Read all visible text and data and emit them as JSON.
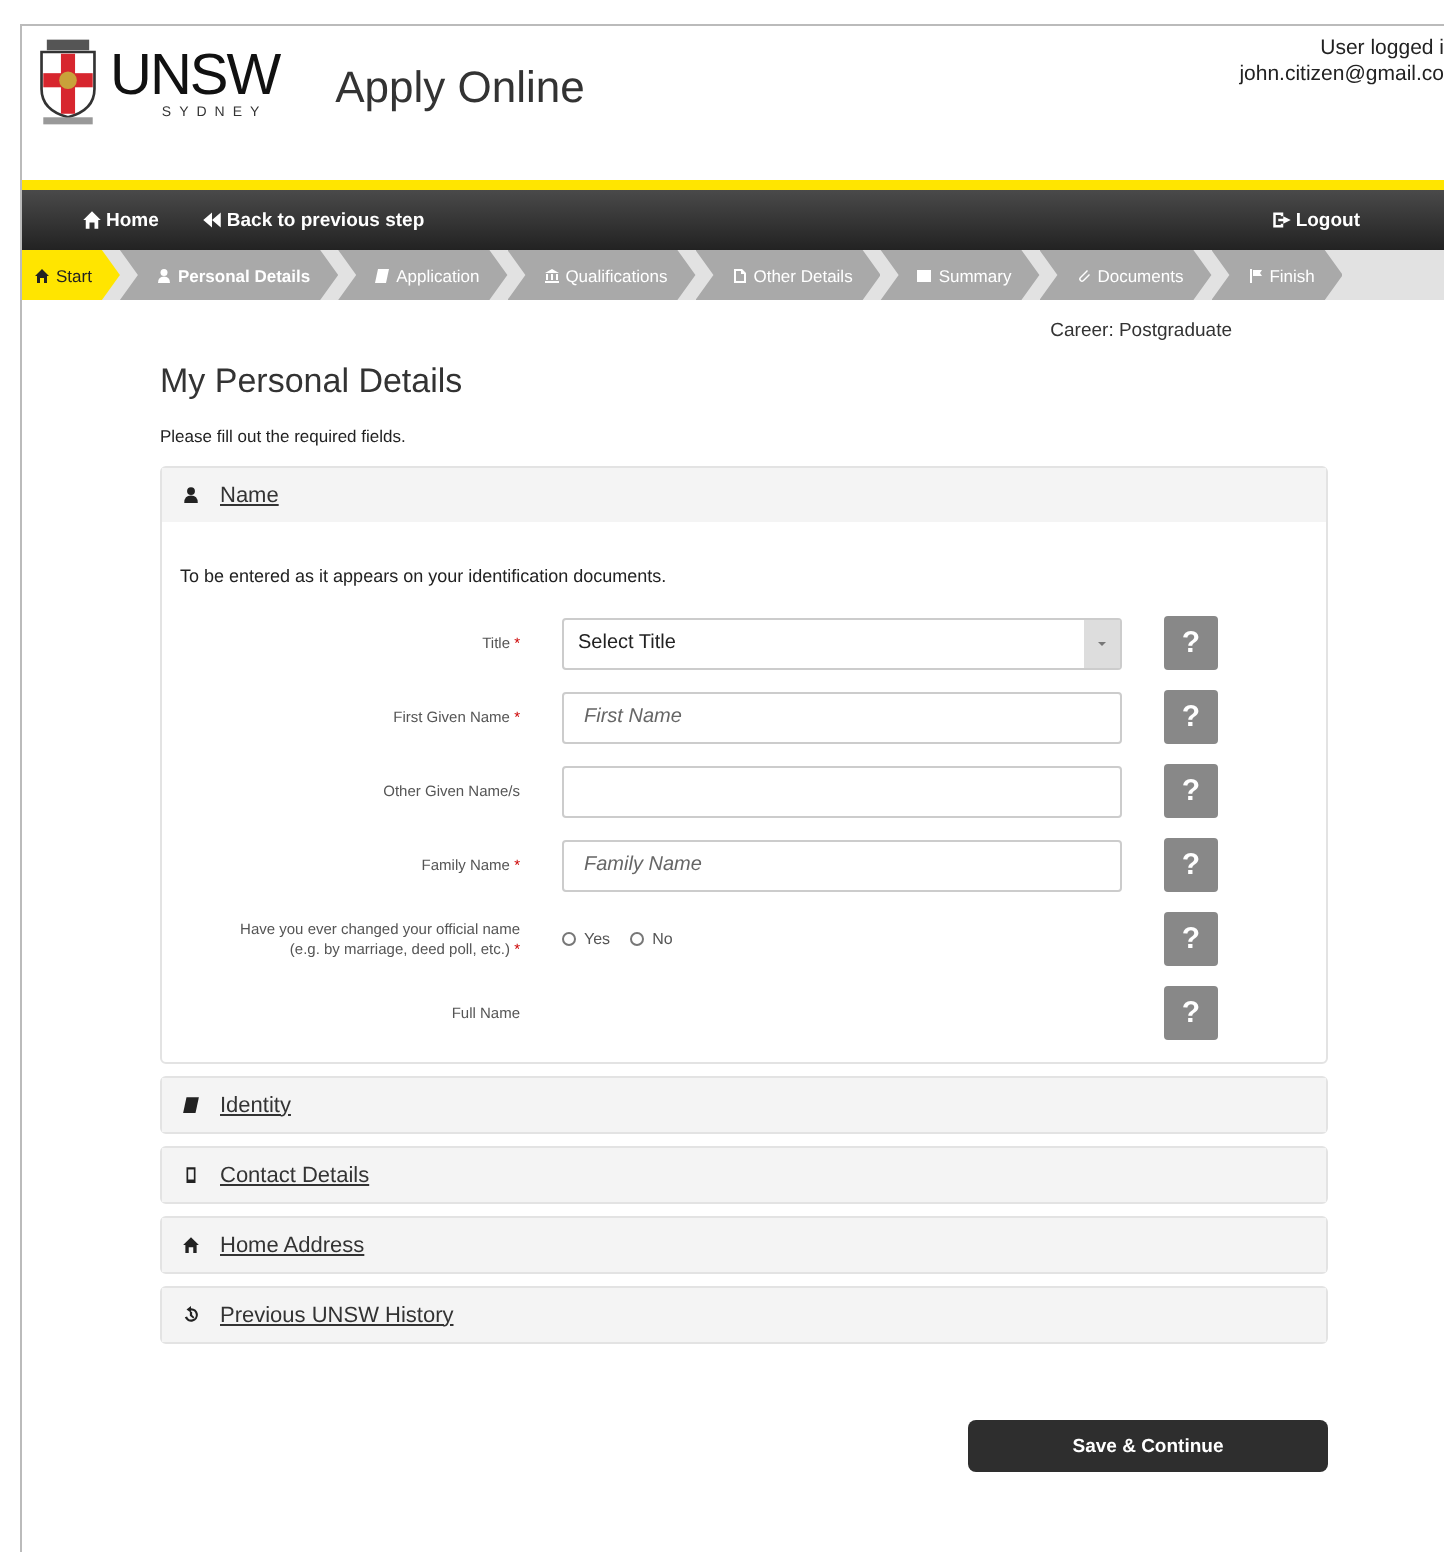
{
  "header": {
    "logo_text": "UNSW",
    "logo_subtext": "SYDNEY",
    "app_title": "Apply Online",
    "user_lines": [
      "User logged i",
      "john.citizen@gmail.co"
    ]
  },
  "nav": {
    "left": [
      {
        "label": "Home"
      },
      {
        "label": "Back to previous step"
      }
    ],
    "right": {
      "label": "Logout"
    }
  },
  "steps": [
    {
      "label": "Start",
      "completed": true,
      "selected": false
    },
    {
      "label": "Personal Details",
      "completed": false,
      "selected": true
    },
    {
      "label": "Application",
      "completed": false,
      "selected": false
    },
    {
      "label": "Qualifications",
      "completed": false,
      "selected": false
    },
    {
      "label": "Other Details",
      "completed": false,
      "selected": false
    },
    {
      "label": "Summary",
      "completed": false,
      "selected": false
    },
    {
      "label": "Documents",
      "completed": false,
      "selected": false
    },
    {
      "label": "Finish",
      "completed": false,
      "selected": false
    }
  ],
  "career": "Career: Postgraduate",
  "page_title": "My Personal Details",
  "instructions": "Please fill out the required fields.",
  "sections": [
    {
      "title": "Name",
      "expanded": true,
      "intro": "To be entered as it appears on your identification documents.",
      "fields": [
        {
          "kind": "select",
          "label": "Title",
          "required_mark": "*",
          "value": "Select Title",
          "help": "?"
        },
        {
          "kind": "text",
          "label": "First Given Name",
          "required_mark": "*",
          "placeholder": "First Name",
          "help": "?"
        },
        {
          "kind": "text",
          "label": "Other Given Name/s",
          "help": "?"
        },
        {
          "kind": "text",
          "label": "Family Name",
          "required_mark": "*",
          "placeholder": "Family Name",
          "help": "?"
        },
        {
          "kind": "radio",
          "label": "Have you ever changed your official name\n(e.g. by marriage, deed poll, etc.)",
          "required_mark": "*",
          "options": [
            {
              "label": "Yes",
              "selected": false
            },
            {
              "label": "No",
              "selected": false
            }
          ],
          "help": "?"
        },
        {
          "kind": "display",
          "label": "Full Name",
          "help": "?"
        }
      ]
    },
    {
      "title": "Identity",
      "expanded": false
    },
    {
      "title": "Contact Details",
      "expanded": false
    },
    {
      "title": "Home Address",
      "expanded": false
    },
    {
      "title": "Previous UNSW History",
      "expanded": false
    }
  ],
  "save_button": "Save & Continue"
}
